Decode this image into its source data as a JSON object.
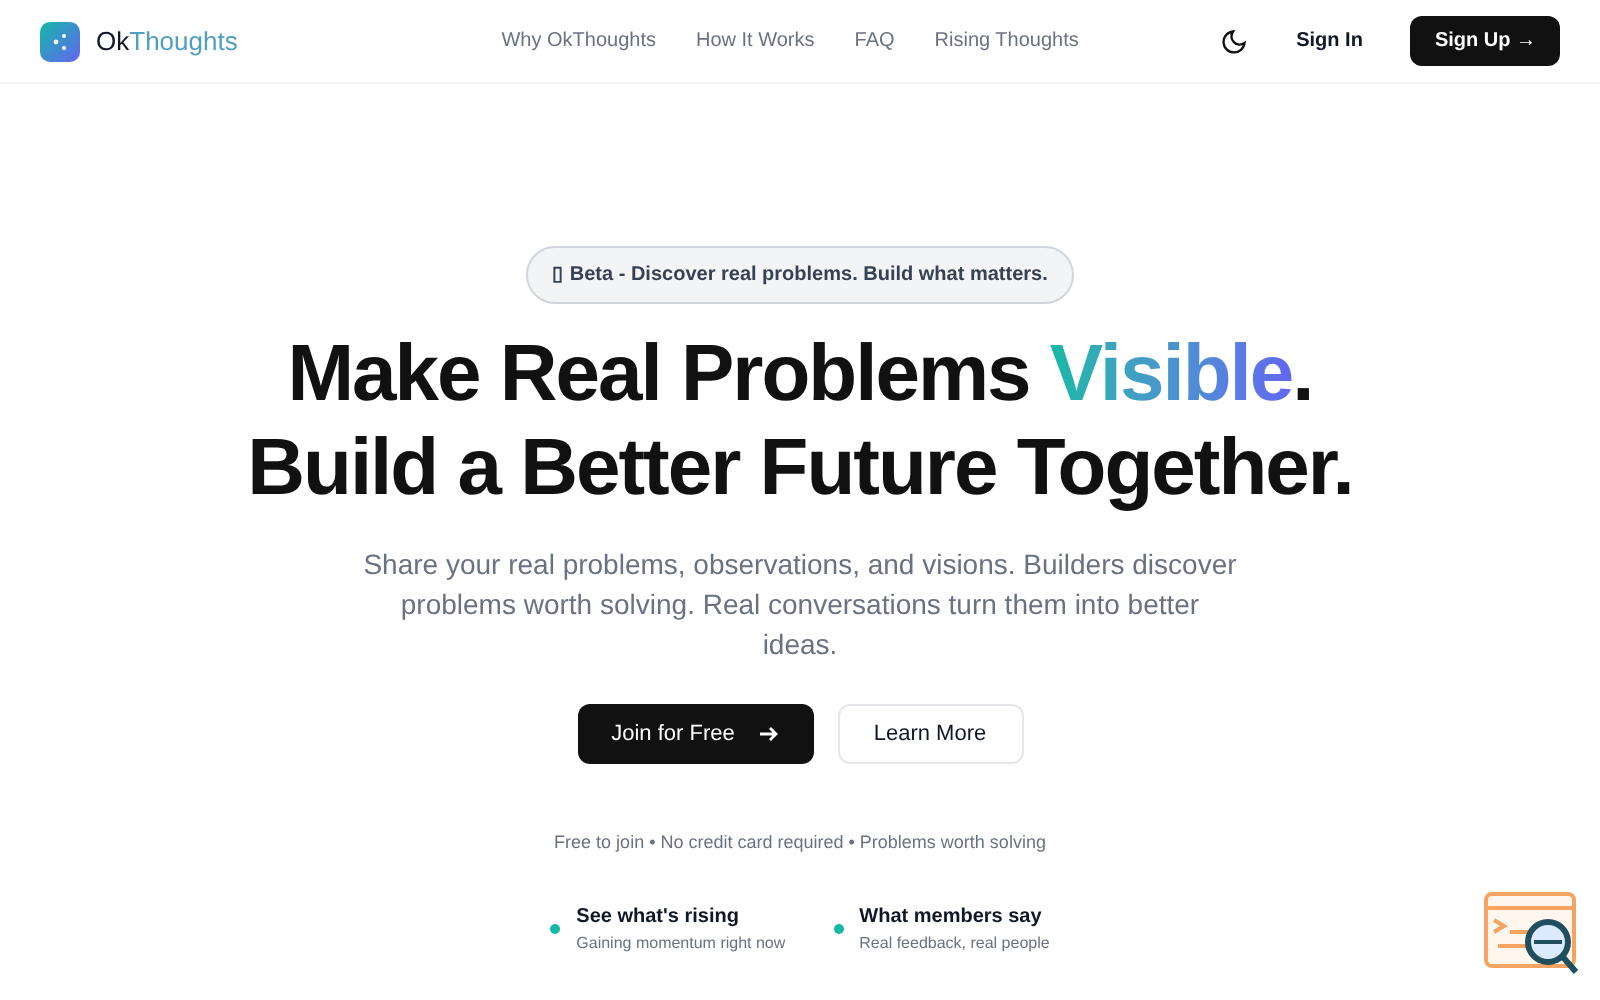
{
  "brand": {
    "prefix": "Ok",
    "suffix": "Thoughts"
  },
  "nav": [
    "Why OkThoughts",
    "How It Works",
    "FAQ",
    "Rising Thoughts"
  ],
  "sign_in": "Sign In",
  "sign_up": "Sign Up →",
  "badge": "▯ Beta - Discover real problems. Build what matters.",
  "headline": {
    "before": "Make Real Problems ",
    "highlight": "Visible",
    "after": ".",
    "line2": "Build a Better Future Together."
  },
  "subtitle": "Share your real problems, observations, and visions. Builders discover problems worth solving. Real conversations turn them into better ideas.",
  "buttons": [
    {
      "label": "Join for Free",
      "kind": "primary"
    },
    {
      "label": "Learn More",
      "kind": "secondary"
    }
  ],
  "note": "Free to join • No credit card required • Problems worth solving",
  "features": [
    {
      "title": "See what's rising",
      "subtitle": "Gaining momentum right now",
      "color": "#14b8a6"
    },
    {
      "title": "What members say",
      "subtitle": "Real feedback, real people",
      "color": "#14b8a6"
    }
  ]
}
